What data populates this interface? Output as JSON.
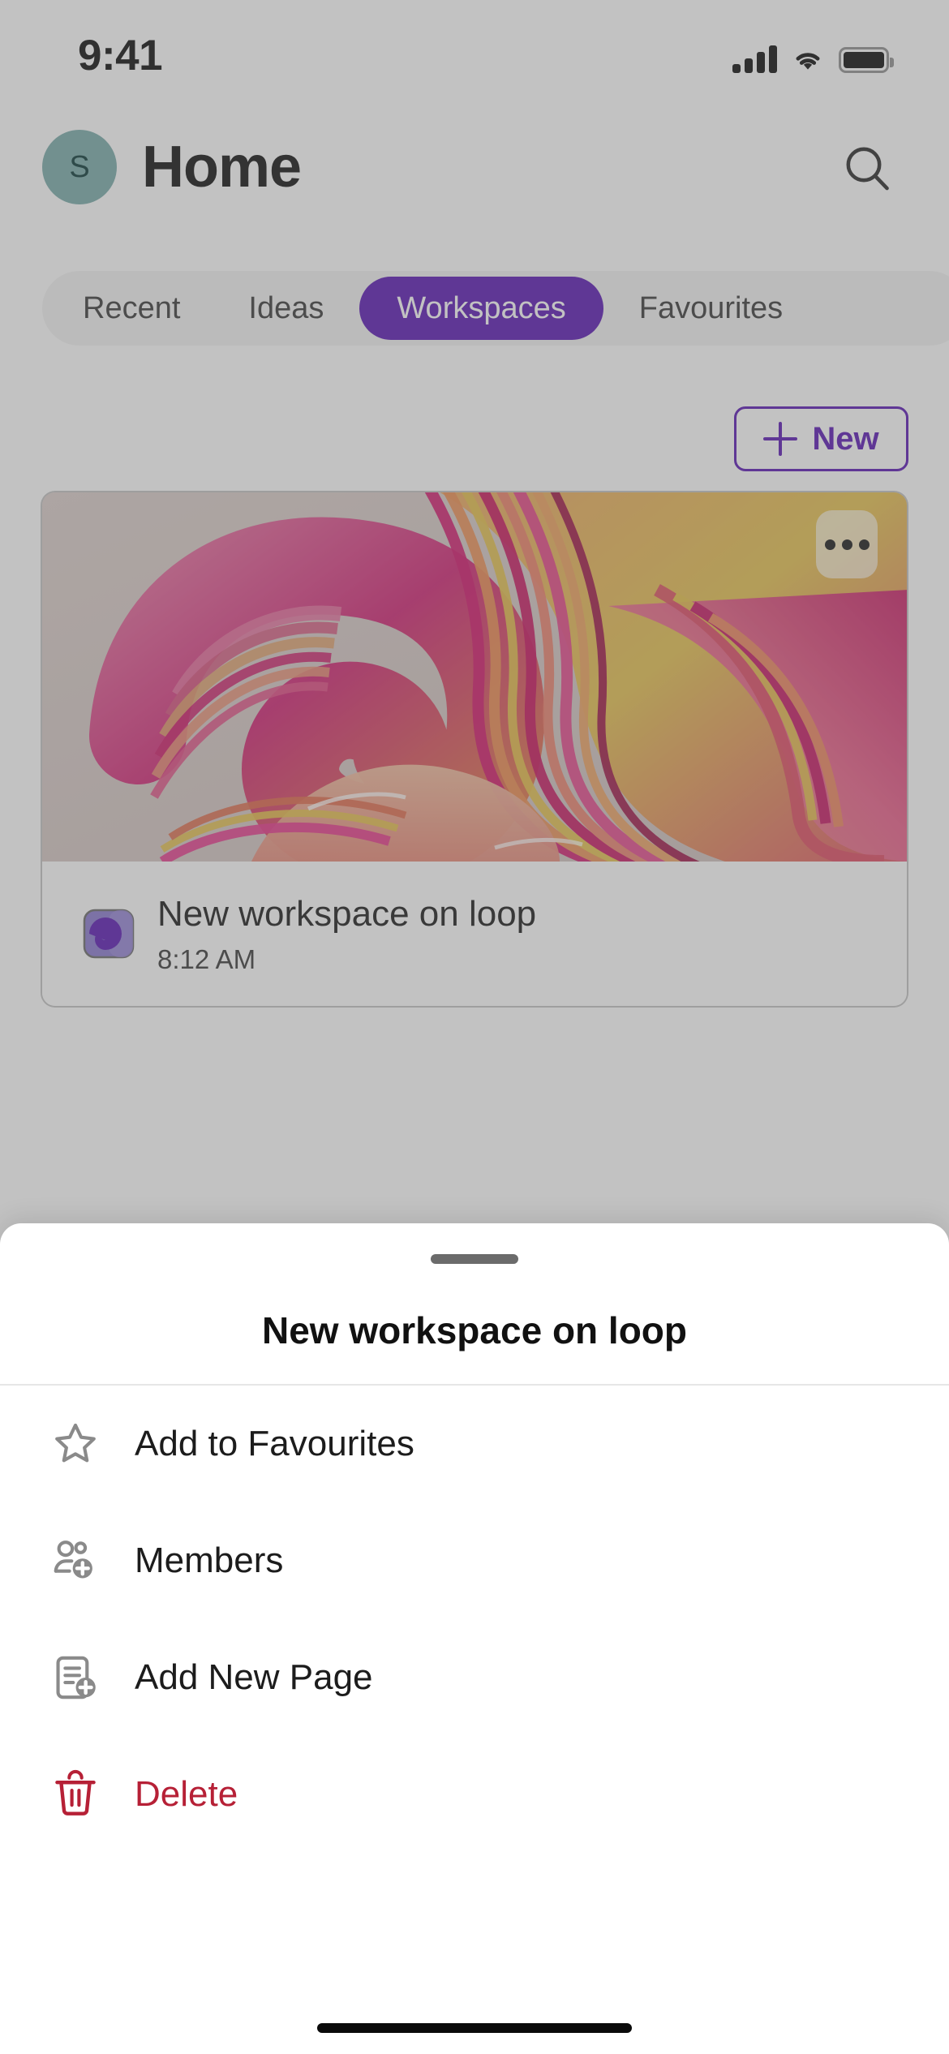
{
  "status_bar": {
    "time": "9:41",
    "signal_icon": "cellular-signal-icon",
    "wifi_icon": "wifi-icon",
    "battery_icon": "battery-full-icon"
  },
  "header": {
    "avatar_initial": "S",
    "title": "Home",
    "search_icon": "search-icon"
  },
  "tabs": [
    {
      "label": "Recent",
      "active": false
    },
    {
      "label": "Ideas",
      "active": false
    },
    {
      "label": "Workspaces",
      "active": true
    },
    {
      "label": "Favourites",
      "active": false
    }
  ],
  "toolbar": {
    "new_label": "New",
    "new_icon": "plus-icon"
  },
  "workspace_card": {
    "title": "New workspace on loop",
    "time": "8:12 AM",
    "app_icon": "microsoft-loop-icon",
    "more_icon": "more-horizontal-icon"
  },
  "bottom_sheet": {
    "title": "New workspace on loop",
    "handle": "drag-handle",
    "menu": [
      {
        "label": "Add to Favourites",
        "icon": "star-outline-icon",
        "destructive": false
      },
      {
        "label": "Members",
        "icon": "people-add-icon",
        "destructive": false
      },
      {
        "label": "Add New Page",
        "icon": "document-add-icon",
        "destructive": false
      },
      {
        "label": "Delete",
        "icon": "trash-icon",
        "destructive": true
      }
    ]
  },
  "colors": {
    "accent_purple": "#5b18b4",
    "destructive_red": "#b62036",
    "avatar_teal": "#7bacab",
    "text_primary": "#1c1c1c",
    "text_secondary": "#3b3b3b",
    "sheet_background": "#ffffff"
  }
}
